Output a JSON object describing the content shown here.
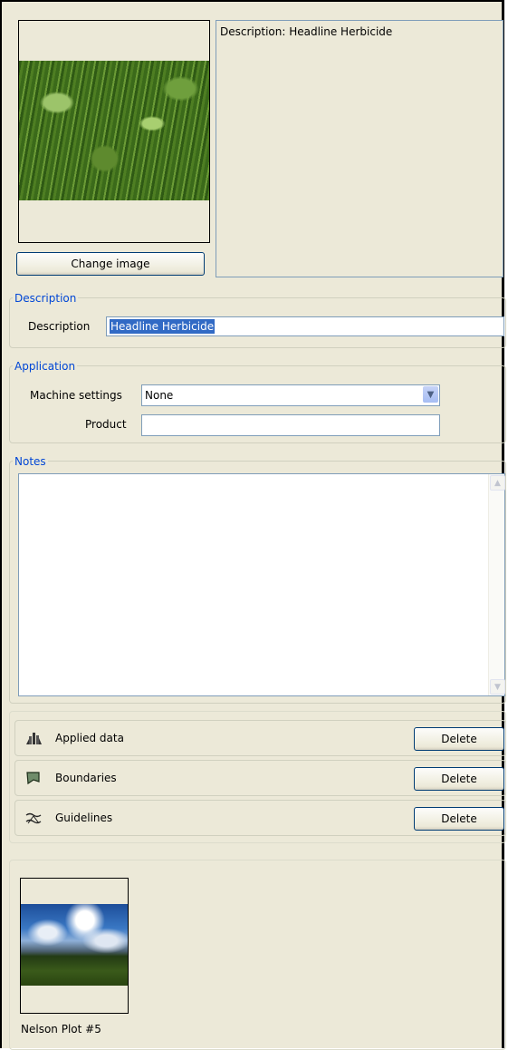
{
  "image_panel": {
    "change_image_label": "Change image"
  },
  "description_preview": {
    "text": "Description: Headline Herbicide"
  },
  "description_group": {
    "legend": "Description",
    "field_label": "Description",
    "field_value": "Headline Herbicide"
  },
  "application_group": {
    "legend": "Application",
    "machine_settings_label": "Machine settings",
    "machine_settings_value": "None",
    "product_label": "Product",
    "product_value": ""
  },
  "notes_group": {
    "legend": "Notes",
    "value": ""
  },
  "data_rows": [
    {
      "label": "Applied data",
      "icon": "applied-data-icon",
      "button": "Delete"
    },
    {
      "label": "Boundaries",
      "icon": "boundaries-icon",
      "button": "Delete"
    },
    {
      "label": "Guidelines",
      "icon": "guidelines-icon",
      "button": "Delete"
    }
  ],
  "gallery": {
    "items": [
      {
        "caption": "Nelson Plot #5"
      }
    ]
  },
  "colors": {
    "panel_bg": "#ece9d8",
    "legend_text": "#0046d5",
    "selection_bg": "#316ac5",
    "field_border": "#7f9db9"
  }
}
